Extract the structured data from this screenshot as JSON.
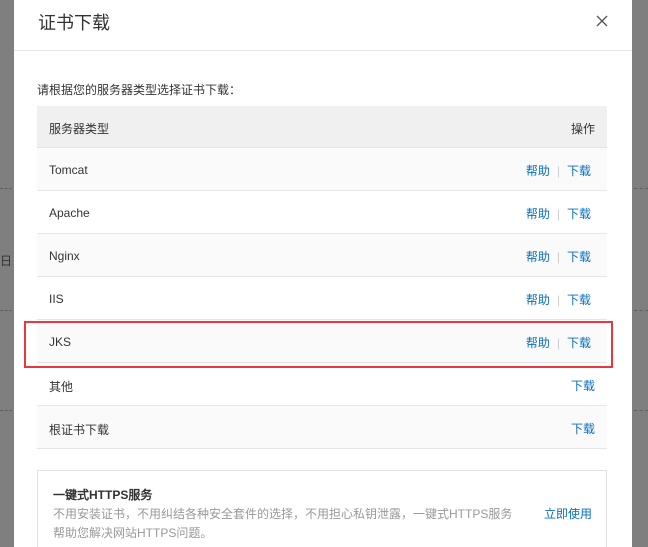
{
  "background": {
    "fragment": "日"
  },
  "modal": {
    "title": "证书下载",
    "close_icon": "close-icon",
    "intro": "请根据您的服务器类型选择证书下载：",
    "table": {
      "header_type": "服务器类型",
      "header_ops": "操作",
      "rows": [
        {
          "name": "Tomcat",
          "help": "帮助",
          "download": "下载"
        },
        {
          "name": "Apache",
          "help": "帮助",
          "download": "下载"
        },
        {
          "name": "Nginx",
          "help": "帮助",
          "download": "下载"
        },
        {
          "name": "IIS",
          "help": "帮助",
          "download": "下载"
        },
        {
          "name": "JKS",
          "help": "帮助",
          "download": "下载"
        },
        {
          "name": "其他",
          "download": "下载"
        },
        {
          "name": "根证书下载",
          "download": "下载"
        }
      ],
      "separator": "|"
    },
    "https": {
      "title": "一键式HTTPS服务",
      "description": "不用安装证书，不用纠结各种安全套件的选择，不用担心私钥泄露，一键式HTTPS服务帮助您解决网站HTTPS问题。",
      "action": "立即使用"
    }
  },
  "colors": {
    "link": "#0a6fc2",
    "highlight": "#e8373d",
    "header_bg": "#f0f0f0"
  }
}
